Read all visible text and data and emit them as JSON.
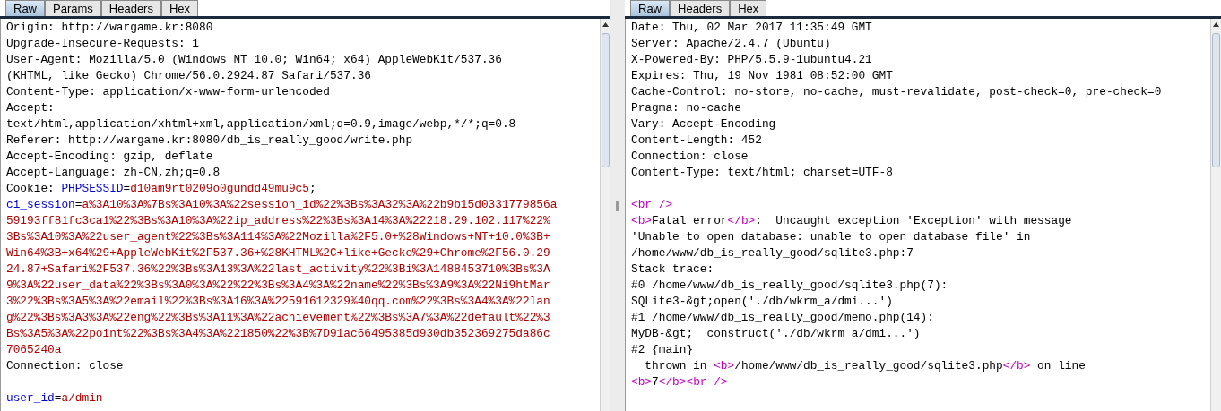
{
  "request": {
    "tabs": [
      {
        "label": "Raw",
        "selected": true
      },
      {
        "label": "Params",
        "selected": false
      },
      {
        "label": "Headers",
        "selected": false
      },
      {
        "label": "Hex",
        "selected": false
      }
    ],
    "lines": [
      {
        "kind": "text",
        "segments": [
          {
            "kind": "plain",
            "text": "Origin: http://wargame.kr:8080"
          }
        ]
      },
      {
        "kind": "text",
        "segments": [
          {
            "kind": "plain",
            "text": "Upgrade-Insecure-Requests: 1"
          }
        ]
      },
      {
        "kind": "text",
        "segments": [
          {
            "kind": "plain",
            "text": "User-Agent: Mozilla/5.0 (Windows NT 10.0; Win64; x64) AppleWebKit/537.36"
          }
        ]
      },
      {
        "kind": "text",
        "segments": [
          {
            "kind": "plain",
            "text": "(KHTML, like Gecko) Chrome/56.0.2924.87 Safari/537.36"
          }
        ]
      },
      {
        "kind": "text",
        "segments": [
          {
            "kind": "plain",
            "text": "Content-Type: application/x-www-form-urlencoded"
          }
        ]
      },
      {
        "kind": "text",
        "segments": [
          {
            "kind": "plain",
            "text": "Accept:"
          }
        ]
      },
      {
        "kind": "text",
        "segments": [
          {
            "kind": "plain",
            "text": "text/html,application/xhtml+xml,application/xml;q=0.9,image/webp,*/*;q=0.8"
          }
        ]
      },
      {
        "kind": "text",
        "segments": [
          {
            "kind": "plain",
            "text": "Referer: http://wargame.kr:8080/db_is_really_good/write.php"
          }
        ]
      },
      {
        "kind": "text",
        "segments": [
          {
            "kind": "plain",
            "text": "Accept-Encoding: gzip, deflate"
          }
        ]
      },
      {
        "kind": "text",
        "segments": [
          {
            "kind": "plain",
            "text": "Accept-Language: zh-CN,zh;q=0.8"
          }
        ]
      },
      {
        "kind": "text",
        "segments": [
          {
            "kind": "plain",
            "text": "Cookie: "
          },
          {
            "kind": "name",
            "text": "PHPSESSID"
          },
          {
            "kind": "plain",
            "text": "="
          },
          {
            "kind": "value",
            "text": "d10am9rt0209o0gundd49mu9c5"
          },
          {
            "kind": "plain",
            "text": ";"
          }
        ]
      },
      {
        "kind": "text",
        "segments": [
          {
            "kind": "name",
            "text": "ci_session"
          },
          {
            "kind": "plain",
            "text": "="
          },
          {
            "kind": "value",
            "text": "a%3A10%3A%7Bs%3A10%3A%22session_id%22%3Bs%3A32%3A%22b9b15d0331779856a"
          }
        ]
      },
      {
        "kind": "text",
        "segments": [
          {
            "kind": "value",
            "text": "59193ff81fc3ca1%22%3Bs%3A10%3A%22ip_address%22%3Bs%3A14%3A%22218.29.102.117%22%"
          }
        ]
      },
      {
        "kind": "text",
        "segments": [
          {
            "kind": "value",
            "text": "3Bs%3A10%3A%22user_agent%22%3Bs%3A114%3A%22Mozilla%2F5.0+%28Windows+NT+10.0%3B+"
          }
        ]
      },
      {
        "kind": "text",
        "segments": [
          {
            "kind": "value",
            "text": "Win64%3B+x64%29+AppleWebKit%2F537.36+%28KHTML%2C+like+Gecko%29+Chrome%2F56.0.29"
          }
        ]
      },
      {
        "kind": "text",
        "segments": [
          {
            "kind": "value",
            "text": "24.87+Safari%2F537.36%22%3Bs%3A13%3A%22last_activity%22%3Bi%3A1488453710%3Bs%3A"
          }
        ]
      },
      {
        "kind": "text",
        "segments": [
          {
            "kind": "value",
            "text": "9%3A%22user_data%22%3Bs%3A0%3A%22%22%3Bs%3A4%3A%22name%22%3Bs%3A9%3A%22Ni9htMar"
          }
        ]
      },
      {
        "kind": "text",
        "segments": [
          {
            "kind": "value",
            "text": "3%22%3Bs%3A5%3A%22email%22%3Bs%3A16%3A%22591612329%40qq.com%22%3Bs%3A4%3A%22lan"
          }
        ]
      },
      {
        "kind": "text",
        "segments": [
          {
            "kind": "value",
            "text": "g%22%3Bs%3A3%3A%22eng%22%3Bs%3A11%3A%22achievement%22%3Bs%3A7%3A%22default%22%3"
          }
        ]
      },
      {
        "kind": "text",
        "segments": [
          {
            "kind": "value",
            "text": "Bs%3A5%3A%22point%22%3Bs%3A4%3A%221850%22%3B%7D91ac66495385d930db352369275da86c"
          }
        ]
      },
      {
        "kind": "text",
        "segments": [
          {
            "kind": "value",
            "text": "7065240a"
          }
        ]
      },
      {
        "kind": "text",
        "segments": [
          {
            "kind": "plain",
            "text": "Connection: close"
          }
        ]
      },
      {
        "kind": "blank"
      },
      {
        "kind": "text",
        "segments": [
          {
            "kind": "name",
            "text": "user_id"
          },
          {
            "kind": "plain",
            "text": "="
          },
          {
            "kind": "value",
            "text": "a/dmin"
          }
        ]
      }
    ]
  },
  "response": {
    "tabs": [
      {
        "label": "Raw",
        "selected": true
      },
      {
        "label": "Headers",
        "selected": false
      },
      {
        "label": "Hex",
        "selected": false
      }
    ],
    "lines": [
      {
        "kind": "text",
        "segments": [
          {
            "kind": "plain",
            "text": "Date: Thu, 02 Mar 2017 11:35:49 GMT"
          }
        ]
      },
      {
        "kind": "text",
        "segments": [
          {
            "kind": "plain",
            "text": "Server: Apache/2.4.7 (Ubuntu)"
          }
        ]
      },
      {
        "kind": "text",
        "segments": [
          {
            "kind": "plain",
            "text": "X-Powered-By: PHP/5.5.9-1ubuntu4.21"
          }
        ]
      },
      {
        "kind": "text",
        "segments": [
          {
            "kind": "plain",
            "text": "Expires: Thu, 19 Nov 1981 08:52:00 GMT"
          }
        ]
      },
      {
        "kind": "text",
        "segments": [
          {
            "kind": "plain",
            "text": "Cache-Control: no-store, no-cache, must-revalidate, post-check=0, pre-check=0"
          }
        ]
      },
      {
        "kind": "text",
        "segments": [
          {
            "kind": "plain",
            "text": "Pragma: no-cache"
          }
        ]
      },
      {
        "kind": "text",
        "segments": [
          {
            "kind": "plain",
            "text": "Vary: Accept-Encoding"
          }
        ]
      },
      {
        "kind": "text",
        "segments": [
          {
            "kind": "plain",
            "text": "Content-Length: 452"
          }
        ]
      },
      {
        "kind": "text",
        "segments": [
          {
            "kind": "plain",
            "text": "Connection: close"
          }
        ]
      },
      {
        "kind": "text",
        "segments": [
          {
            "kind": "plain",
            "text": "Content-Type: text/html; charset=UTF-8"
          }
        ]
      },
      {
        "kind": "blank"
      },
      {
        "kind": "text",
        "segments": [
          {
            "kind": "tag",
            "text": "<br />"
          }
        ]
      },
      {
        "kind": "text",
        "segments": [
          {
            "kind": "tag",
            "text": "<b>"
          },
          {
            "kind": "plain",
            "text": "Fatal error"
          },
          {
            "kind": "tag",
            "text": "</b>"
          },
          {
            "kind": "plain",
            "text": ":  Uncaught exception 'Exception' with message"
          }
        ]
      },
      {
        "kind": "text",
        "segments": [
          {
            "kind": "plain",
            "text": "'Unable to open database: unable to open database file' in"
          }
        ]
      },
      {
        "kind": "text",
        "segments": [
          {
            "kind": "plain",
            "text": "/home/www/db_is_really_good/sqlite3.php:7"
          }
        ]
      },
      {
        "kind": "text",
        "segments": [
          {
            "kind": "plain",
            "text": "Stack trace:"
          }
        ]
      },
      {
        "kind": "text",
        "segments": [
          {
            "kind": "plain",
            "text": "#0 /home/www/db_is_really_good/sqlite3.php(7):"
          }
        ]
      },
      {
        "kind": "text",
        "segments": [
          {
            "kind": "plain",
            "text": "SQLite3-&gt;open('./db/wkrm_a/dmi...')"
          }
        ]
      },
      {
        "kind": "text",
        "segments": [
          {
            "kind": "plain",
            "text": "#1 /home/www/db_is_really_good/memo.php(14):"
          }
        ]
      },
      {
        "kind": "text",
        "segments": [
          {
            "kind": "plain",
            "text": "MyDB-&gt;__construct('./db/wkrm_a/dmi...')"
          }
        ]
      },
      {
        "kind": "text",
        "segments": [
          {
            "kind": "plain",
            "text": "#2 {main}"
          }
        ]
      },
      {
        "kind": "text",
        "segments": [
          {
            "kind": "plain",
            "text": "  thrown in "
          },
          {
            "kind": "tag",
            "text": "<b>"
          },
          {
            "kind": "plain",
            "text": "/home/www/db_is_really_good/sqlite3.php"
          },
          {
            "kind": "tag",
            "text": "</b>"
          },
          {
            "kind": "plain",
            "text": " on line"
          }
        ]
      },
      {
        "kind": "text",
        "segments": [
          {
            "kind": "tag",
            "text": "<b>"
          },
          {
            "kind": "plain",
            "text": "7"
          },
          {
            "kind": "tag",
            "text": "</b>"
          },
          {
            "kind": "tag",
            "text": "<br />"
          }
        ]
      }
    ]
  }
}
